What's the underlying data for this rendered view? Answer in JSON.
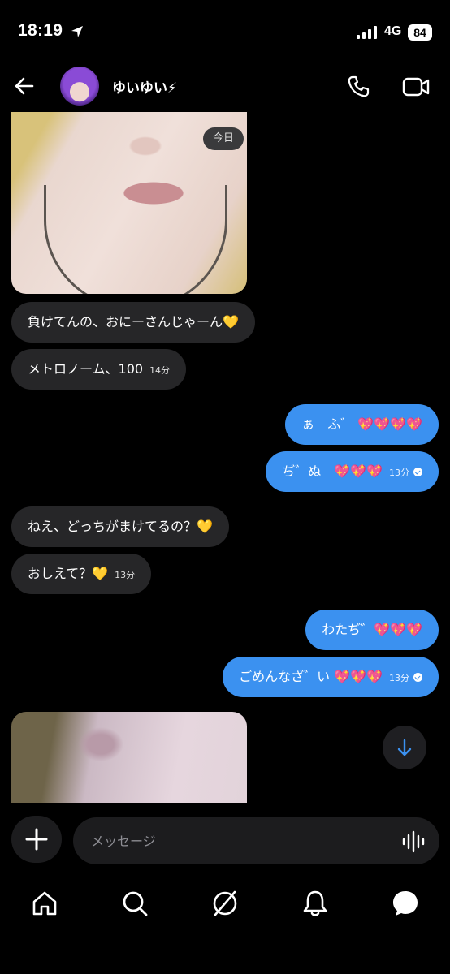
{
  "status_bar": {
    "time": "18:19",
    "network": "4G",
    "battery": "84"
  },
  "header": {
    "username": "ゆいゆい⚡"
  },
  "chat": {
    "date_badge": "今日",
    "messages": [
      {
        "side": "in",
        "text": "負けてんの、おにーさんじゃーん💛",
        "time": ""
      },
      {
        "side": "in",
        "text": "メトロノーム、100",
        "time": "14分"
      },
      {
        "side": "out",
        "text": "ぁ　ふ゛ 💖💖💖💖",
        "time": ""
      },
      {
        "side": "out",
        "text": "ぢ゛ぬ　💖💖💖",
        "time": "13分"
      },
      {
        "side": "in",
        "text": "ねえ、どっちがまけてるの？💛",
        "time": ""
      },
      {
        "side": "in",
        "text": "おしえて？💛",
        "time": "13分"
      },
      {
        "side": "out",
        "text": "わたぢ゛💖💖💖",
        "time": ""
      },
      {
        "side": "out",
        "text": "ごめんなざ゛い 💖💖💖",
        "time": "13分"
      }
    ]
  },
  "composer": {
    "placeholder": "メッセージ"
  },
  "icons": {
    "back": "back-arrow-icon",
    "call": "phone-icon",
    "video": "video-camera-icon",
    "plus": "plus-icon",
    "voice": "voice-wave-icon",
    "scroll": "arrow-down-icon",
    "tabs": [
      "home-icon",
      "search-icon",
      "explore-icon",
      "bell-icon",
      "chat-icon"
    ]
  },
  "colors": {
    "background": "#000000",
    "incoming_bubble": "#262628",
    "outgoing_bubble": "#3b91f0"
  }
}
